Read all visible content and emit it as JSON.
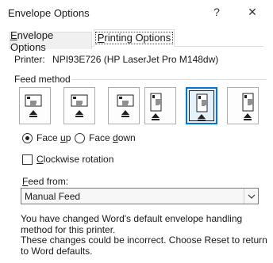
{
  "window": {
    "title": "Envelope Options",
    "help_glyph": "?",
    "close_glyph": "✕"
  },
  "tabs": [
    {
      "label_first": "E",
      "label_rest": "nvelope Options",
      "active": false
    },
    {
      "label_first": "P",
      "label_rest": "rinting Options",
      "active": true
    }
  ],
  "printer": {
    "label": "Printer:",
    "name": "NPI93E726 (HP LaserJet Pro M148dw)"
  },
  "feed_method": {
    "label": "Feed method",
    "options": [
      {
        "icon": "feed-landscape-left-icon",
        "selected": false
      },
      {
        "icon": "feed-landscape-center-icon",
        "selected": false
      },
      {
        "icon": "feed-landscape-right-icon",
        "selected": false
      },
      {
        "icon": "feed-portrait-left-icon",
        "selected": false
      },
      {
        "icon": "feed-portrait-center-icon",
        "selected": true
      },
      {
        "icon": "feed-portrait-right-icon",
        "selected": false
      }
    ]
  },
  "orientation": {
    "face_up": {
      "prefix": "Face ",
      "underlined": "u",
      "suffix": "p",
      "checked": true
    },
    "face_down": {
      "prefix": "Face ",
      "underlined": "d",
      "suffix": "own",
      "checked": false
    }
  },
  "clockwise": {
    "underlined": "C",
    "rest": "lockwise rotation",
    "checked": false
  },
  "feed_from": {
    "label_underlined": "F",
    "label_rest": "eed from:",
    "value": "Manual Feed"
  },
  "note": {
    "line1": "You have changed Word's default envelope handling method for this printer.",
    "line2": "These changes could be incorrect. Choose Reset to return to Word defaults."
  },
  "colors": {
    "accent": "#0078d7",
    "border": "#adadad"
  }
}
